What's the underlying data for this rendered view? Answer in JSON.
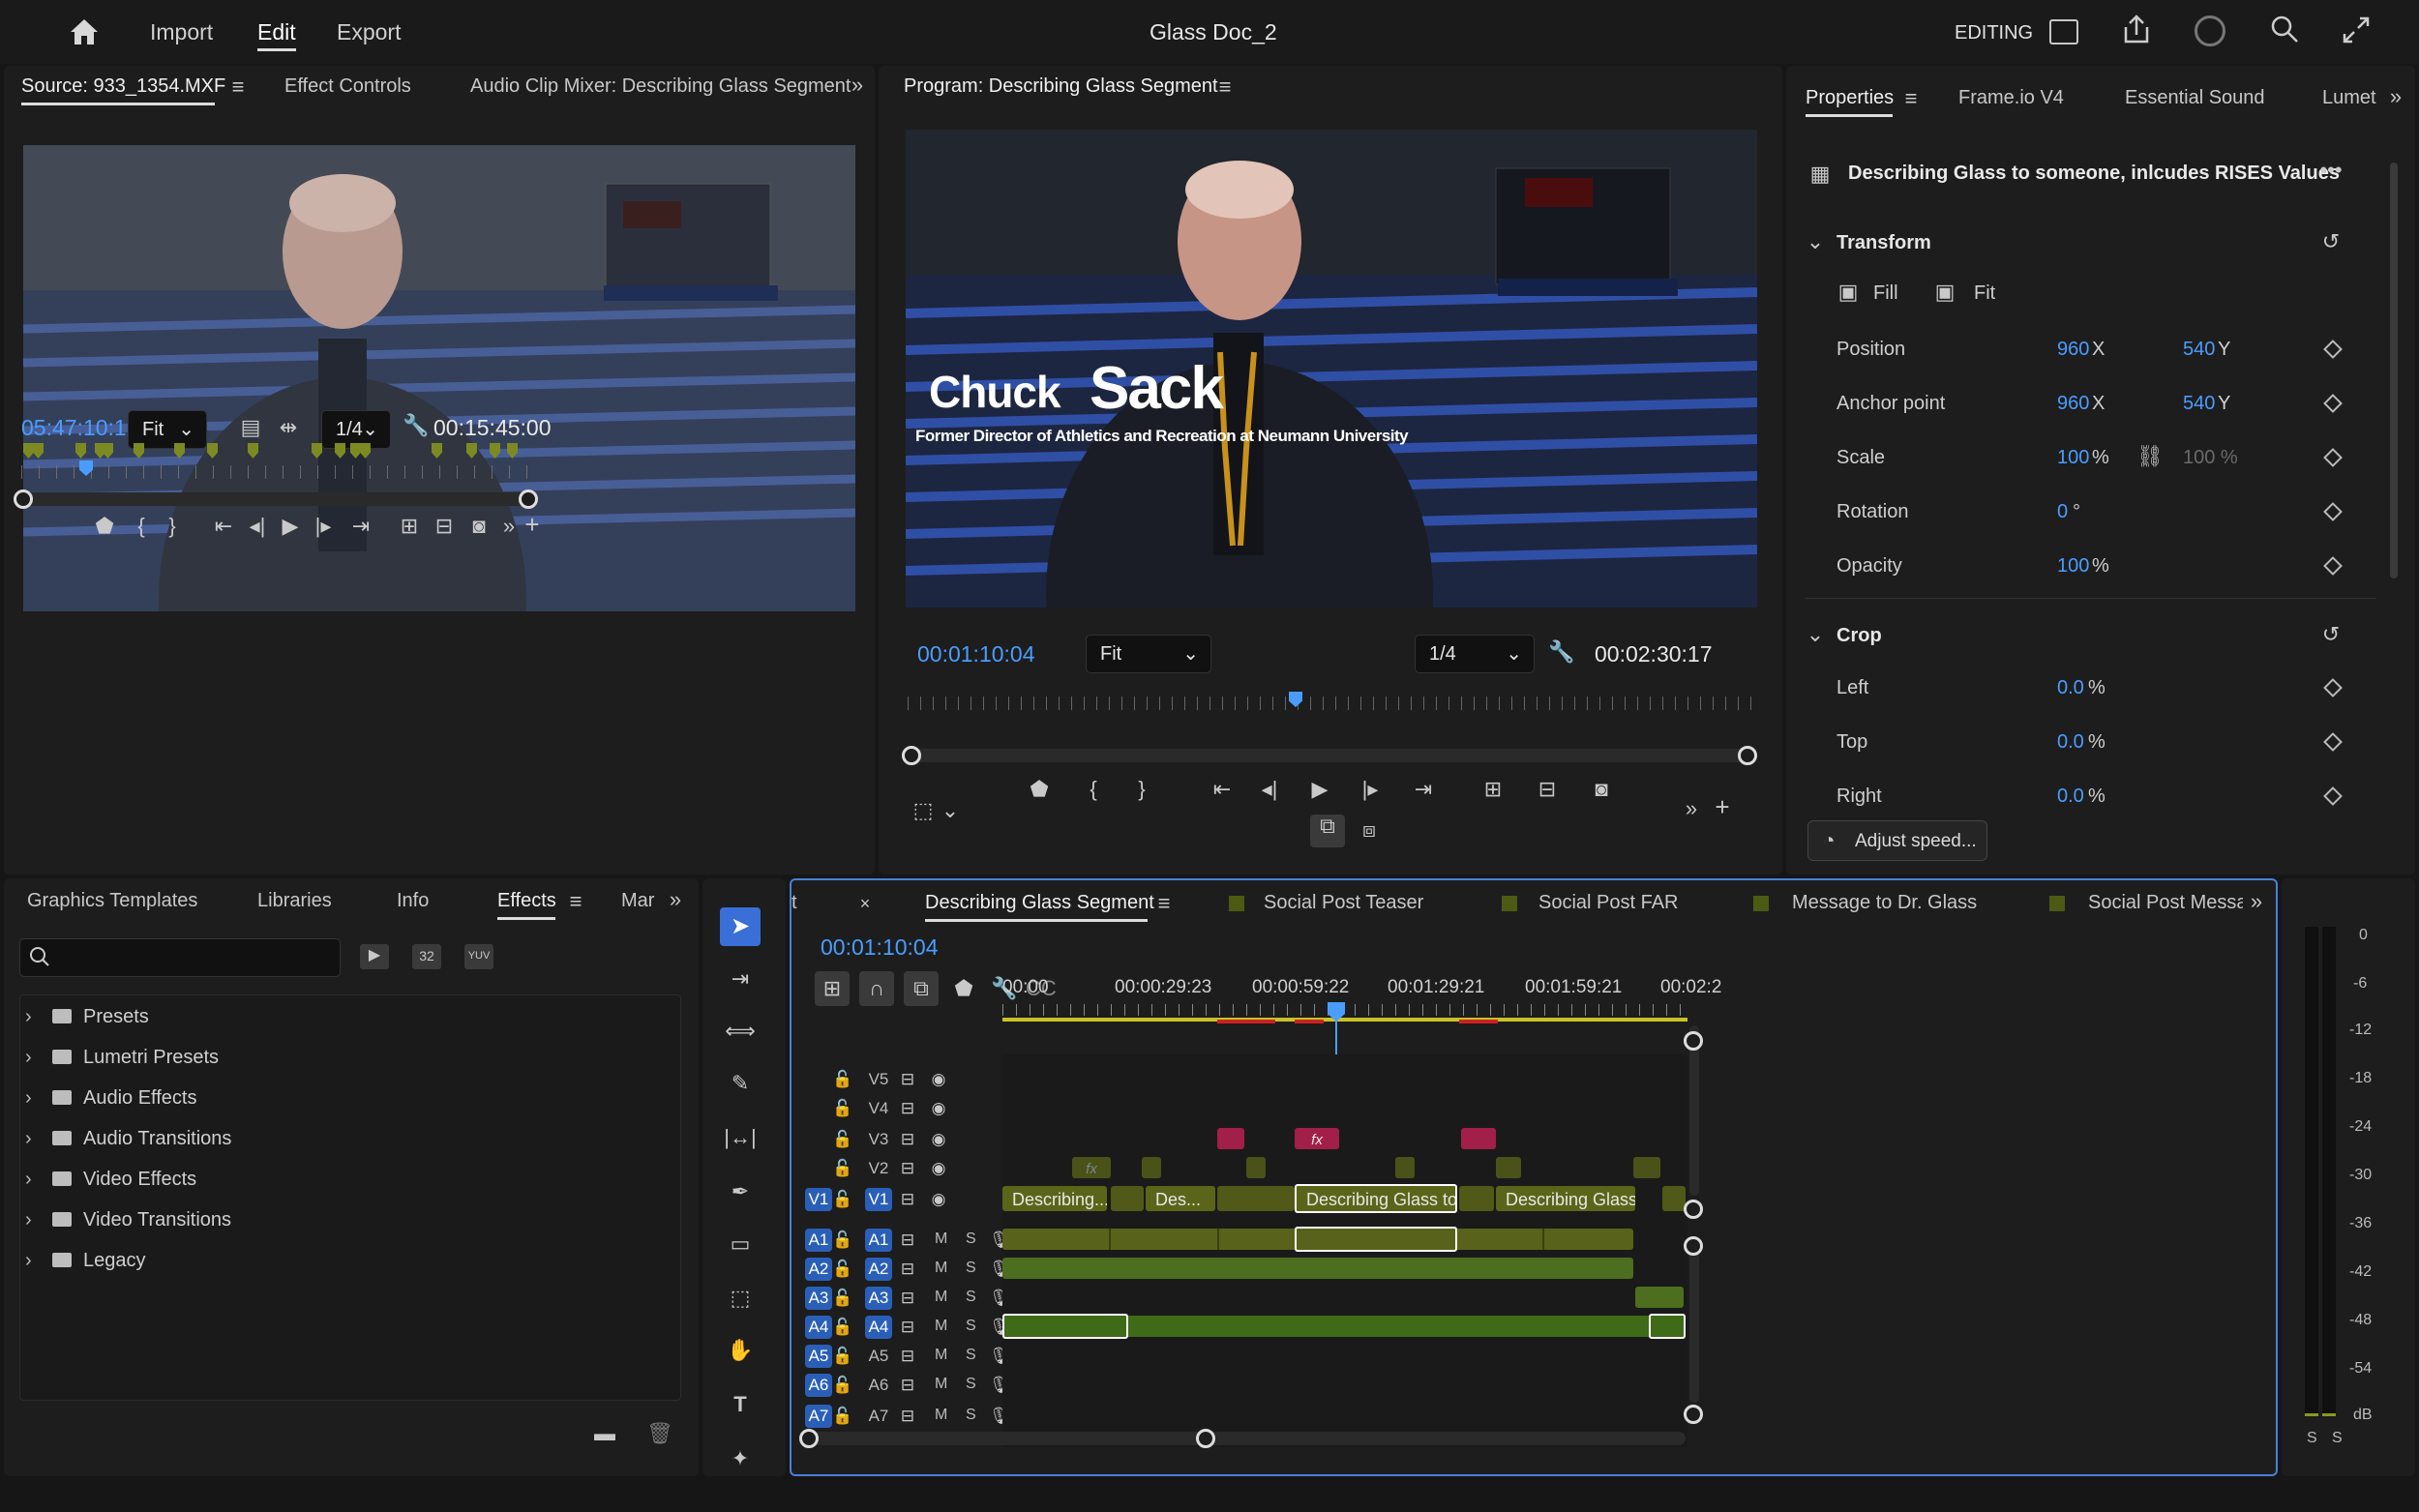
{
  "topbar": {
    "menu": [
      "Import",
      "Edit",
      "Export"
    ],
    "active": "Edit",
    "title": "Glass Doc_2",
    "mode": "EDITING"
  },
  "source": {
    "tabs": [
      "Source: 933_1354.MXF",
      "Effect Controls",
      "Audio Clip Mixer: Describing Glass Segment"
    ],
    "timecode": "05:47:10:12",
    "fit": "Fit",
    "res": "1/4",
    "duration": "00:15:45:00"
  },
  "program": {
    "tab": "Program: Describing Glass Segment",
    "timecode": "00:01:10:04",
    "fit": "Fit",
    "res": "1/4",
    "duration": "00:02:30:17",
    "lower_third_name_a": "Chuck",
    "lower_third_name_b": "Sack",
    "lower_third_sub": "Former Director of Athletics and Recreation at Neumann University"
  },
  "properties": {
    "tabs": [
      "Properties",
      "Frame.io V4",
      "Essential Sound",
      "Lumet"
    ],
    "clip_name": "Describing Glass to someone, inlcudes RISES Values",
    "transform": {
      "title": "Transform",
      "fill": "Fill",
      "fit": "Fit",
      "rows": [
        {
          "label": "Position",
          "v1": "960",
          "u1": "X",
          "v2": "540",
          "u2": "Y"
        },
        {
          "label": "Anchor point",
          "v1": "960",
          "u1": "X",
          "v2": "540",
          "u2": "Y"
        },
        {
          "label": "Scale",
          "v1": "100",
          "u1": "%",
          "v2": "100 %",
          "u2": ""
        },
        {
          "label": "Rotation",
          "v1": "0",
          "u1": "°",
          "v2": "",
          "u2": ""
        },
        {
          "label": "Opacity",
          "v1": "100",
          "u1": "%",
          "v2": "",
          "u2": ""
        }
      ]
    },
    "crop": {
      "title": "Crop",
      "rows": [
        {
          "label": "Left",
          "v1": "0.0",
          "u1": "%"
        },
        {
          "label": "Top",
          "v1": "0.0",
          "u1": "%"
        },
        {
          "label": "Right",
          "v1": "0.0",
          "u1": "%"
        }
      ]
    },
    "adjust_speed": "Adjust speed..."
  },
  "effects": {
    "tabs": [
      "Graphics Templates",
      "Libraries",
      "Info",
      "Effects",
      "Mar"
    ],
    "active": "Effects",
    "search_placeholder": "",
    "items": [
      "Presets",
      "Lumetri Presets",
      "Audio Effects",
      "Audio Transitions",
      "Video Effects",
      "Video Transitions",
      "Legacy"
    ]
  },
  "timeline": {
    "tabs": [
      "t",
      "Describing Glass Segment",
      "Social Post Teaser",
      "Social Post FAR",
      "Message to Dr. Glass",
      "Social Post Messag"
    ],
    "timecode": "00:01:10:04",
    "ruler": [
      "00:00",
      "00:00:29:23",
      "00:00:59:22",
      "00:01:29:21",
      "00:01:59:21",
      "00:02:2"
    ],
    "video_tracks": [
      "V5",
      "V4",
      "V3",
      "V2",
      "V1"
    ],
    "audio_tracks": [
      "A1",
      "A2",
      "A3",
      "A4",
      "A5",
      "A6",
      "A7"
    ],
    "ms": [
      "M",
      "S"
    ],
    "clips": {
      "v1_a": "Describing...",
      "v1_b": "Des...",
      "v1_c": "Describing Glass to s",
      "v1_d": "Describing Glass to..",
      "fx": "fx"
    }
  },
  "meter": {
    "scale": [
      "0",
      "-6",
      "-12",
      "-18",
      "-24",
      "-30",
      "-36",
      "-42",
      "-48",
      "-54",
      "dB"
    ],
    "solo": [
      "S",
      "S"
    ]
  }
}
